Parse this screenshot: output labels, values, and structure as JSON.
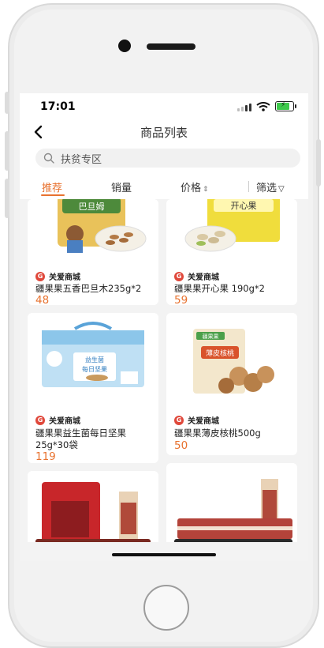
{
  "status_bar": {
    "time": "17:01"
  },
  "nav": {
    "title": "商品列表"
  },
  "search": {
    "text": "扶贫专区"
  },
  "sort": {
    "items": [
      "推荐",
      "销量",
      "价格",
      "筛选"
    ],
    "price_caret": "⇕",
    "filter_icon": "▽"
  },
  "products": [
    {
      "shop_logo": "G",
      "shop": "关爱商城",
      "name": "疆果果五香巴旦木235g*2",
      "price": "48"
    },
    {
      "shop_logo": "G",
      "shop": "关爱商城",
      "name": "疆果果开心果 190g*2",
      "price": "59"
    },
    {
      "shop_logo": "G",
      "shop": "关爱商城",
      "name": "疆果果益生菌每日坚果25g*30袋",
      "price": "119"
    },
    {
      "shop_logo": "G",
      "shop": "关爱商城",
      "name": "疆果果薄皮核桃500g",
      "price": "50"
    }
  ],
  "images": {
    "badamu_label": "巴旦姆",
    "kaixin_label": "开心果",
    "daily_label": "每日坚果",
    "daily_sub": "益生菌",
    "walnut_label": "薄皮核桃",
    "walnut_brand": "疆果果"
  },
  "colors": {
    "accent": "#e8722f",
    "shop_logo": "#e0483b"
  }
}
